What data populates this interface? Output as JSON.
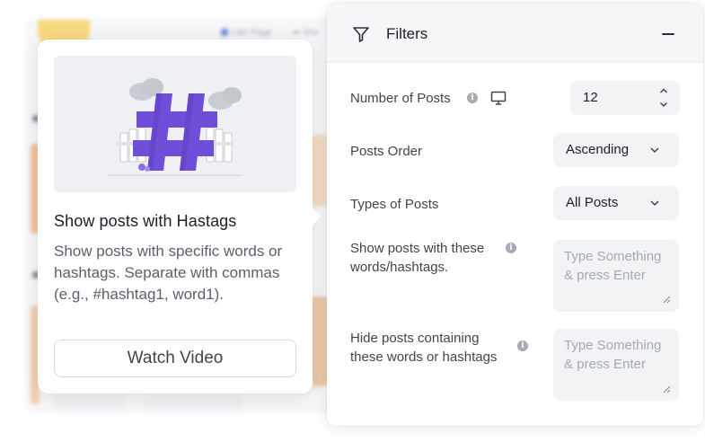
{
  "background": {
    "top_links": [
      "Like Page",
      "Sha"
    ]
  },
  "card": {
    "illustration": "hashtag-illustration",
    "title": "Show posts with Hastags",
    "description": "Show posts with specific words or hashtags. Separate with commas (e.g., #hashtag1, word1).",
    "button_label": "Watch Video"
  },
  "filters": {
    "title": "Filters",
    "icon": "filter-icon",
    "collapse_icon": "minus-icon",
    "number_of_posts": {
      "label": "Number of Posts",
      "value": "12"
    },
    "posts_order": {
      "label": "Posts Order",
      "value": "Ascending"
    },
    "types_of_posts": {
      "label": "Types of Posts",
      "value": "All Posts"
    },
    "show_posts": {
      "label_line1": "Show posts with these",
      "label_line2": "words/hashtags.",
      "placeholder": "Type Something & press Enter"
    },
    "hide_posts": {
      "label_line1": "Hide posts containing",
      "label_line2": "these words or hashtags",
      "placeholder": "Type Something & press Enter"
    }
  },
  "colors": {
    "accent_purple": "#6f4fd8",
    "panel_header_bg": "#f5f6f7",
    "field_bg": "#f2f3f5"
  }
}
